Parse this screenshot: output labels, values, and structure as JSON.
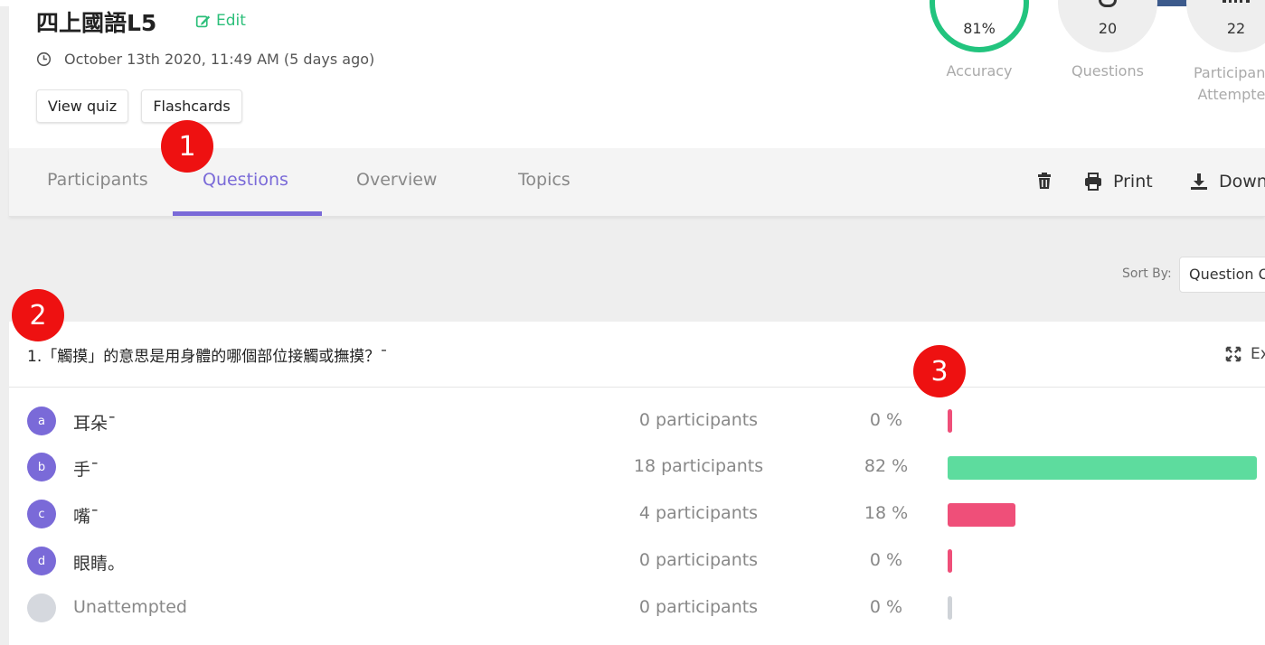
{
  "quiz": {
    "title": "四上國語L5",
    "edit_label": "Edit",
    "date": "October 13th 2020, 11:49 AM (5 days ago)",
    "view_quiz_label": "View quiz",
    "flashcards_label": "Flashcards"
  },
  "stats": {
    "accuracy": {
      "value": "81%",
      "label": "Accuracy",
      "fraction": 0.81
    },
    "questions": {
      "value": "20",
      "label": "Questions"
    },
    "participants": {
      "value": "22",
      "label": "Participants Attempted"
    }
  },
  "tabs": [
    {
      "label": "Participants"
    },
    {
      "label": "Questions"
    },
    {
      "label": "Overview"
    },
    {
      "label": "Topics"
    }
  ],
  "toolbar": {
    "print_label": "Print",
    "download_label": "Download"
  },
  "sort": {
    "label": "Sort By:",
    "value": "Question Order"
  },
  "question": {
    "text": "1.「觸摸」的意思是用身體的哪個部位接觸或撫摸？¯",
    "expand_label": "Expand",
    "options": [
      {
        "letter": "a",
        "text": "耳朵¯",
        "count": "0 participants",
        "percent": "0 %",
        "share": 0
      },
      {
        "letter": "b",
        "text": "手¯",
        "count": "18 participants",
        "percent": "82 %",
        "share": 0.82
      },
      {
        "letter": "c",
        "text": "嘴¯",
        "count": "4 participants",
        "percent": "18 %",
        "share": 0.18
      },
      {
        "letter": "d",
        "text": "眼睛。",
        "count": "0 participants",
        "percent": "0 %",
        "share": 0
      },
      {
        "letter": "",
        "text": "Unattempted",
        "count": "0 participants",
        "percent": "0 %",
        "share": 0
      }
    ]
  },
  "colors": {
    "accent": "#7a6ad8",
    "correct": "#5ddc9e",
    "incorrect": "#ef4f79",
    "unattempted": "#cfd3d8",
    "accuracy_ring": "#22c47e",
    "edit": "#2cbf7a",
    "annotation": "#ee1111"
  },
  "annotations": [
    "1",
    "2",
    "3"
  ]
}
